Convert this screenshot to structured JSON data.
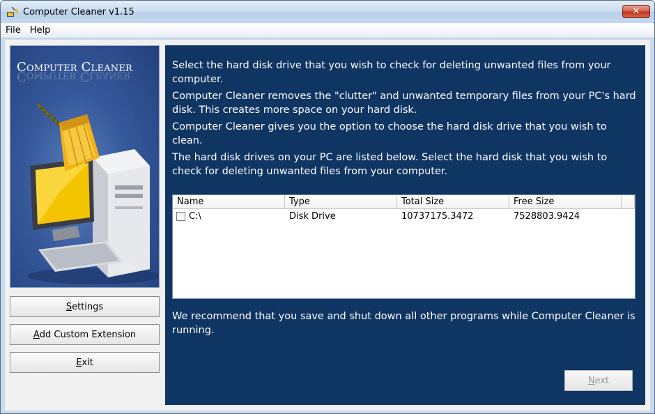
{
  "window": {
    "title": "Computer Cleaner v1.15",
    "close_glyph": "✕"
  },
  "menu": [
    {
      "label": "File"
    },
    {
      "label": "Help"
    }
  ],
  "logo": {
    "title": "Computer Cleaner",
    "colors": {
      "panel": "#2c4d8e",
      "broom": "#f2b31a",
      "screen": "#f5c400"
    }
  },
  "sidebar_buttons": {
    "settings": {
      "label_u": "S",
      "label_rest": "ettings"
    },
    "add_ext": {
      "label_u": "A",
      "label_rest": "dd Custom Extension"
    },
    "exit": {
      "label_u": "E",
      "label_rest": "xit"
    }
  },
  "content": {
    "para1": "Select the hard disk drive that you wish to check for deleting unwanted files from your computer.",
    "para2": "Computer Cleaner removes the \"clutter\" and unwanted temporary files from your PC's hard disk. This creates more space on your hard disk.",
    "para3": "Computer Cleaner gives you the option to choose the hard disk drive that you wish to clean.",
    "para4": "The hard disk drives on your PC are listed below. Select the hard disk that you wish to check for deleting unwanted files from your computer.",
    "recommend": "We recommend that you save and shut down all other programs while Computer Cleaner is running."
  },
  "table": {
    "columns": [
      "Name",
      "Type",
      "Total Size",
      "Free Size"
    ],
    "rows": [
      {
        "name": "C:\\",
        "type": "Disk Drive",
        "total": "10737175.3472",
        "free": "7528803.9424",
        "checked": false
      }
    ]
  },
  "next_button": {
    "label_u": "N",
    "label_rest": "ext",
    "enabled": false
  }
}
